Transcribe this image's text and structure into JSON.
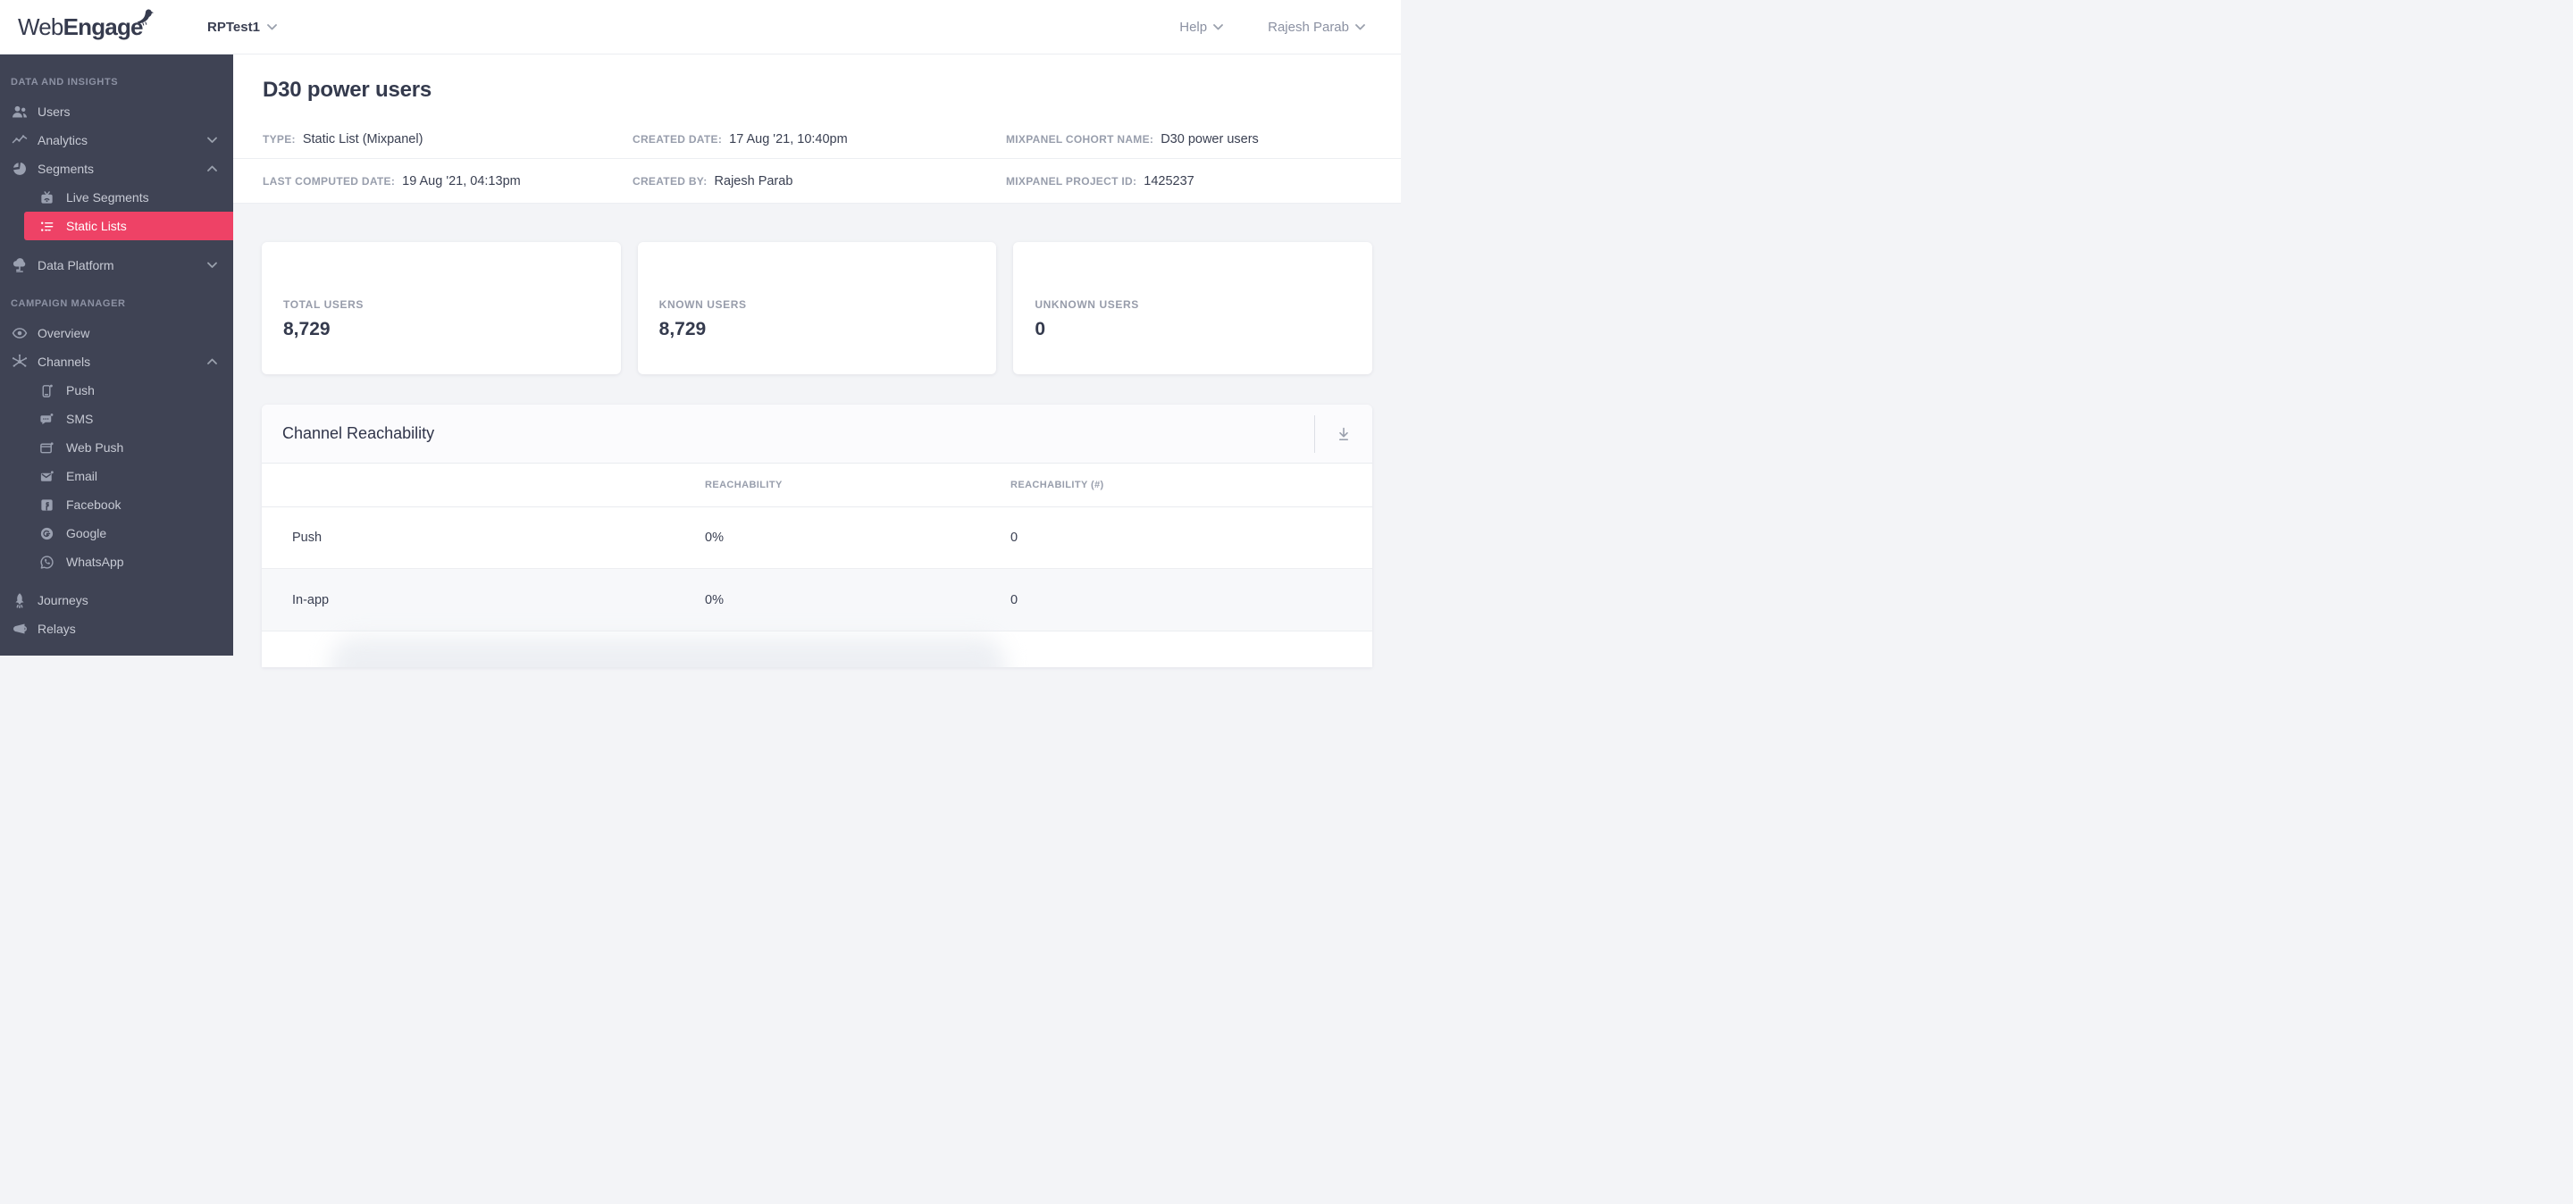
{
  "brand": {
    "light": "Web",
    "bold": "Engage"
  },
  "topbar": {
    "workspace": "RPTest1",
    "help": "Help",
    "user": "Rajesh Parab"
  },
  "colors": {
    "accent": "#ee4266",
    "sidebar_bg": "#3f4354"
  },
  "icons": {
    "brand": "webengage-bird-icon",
    "workspace": "chevron-down-icon",
    "download": "download-icon"
  },
  "sidebar": {
    "section1": "DATA AND INSIGHTS",
    "section2": "CAMPAIGN MANAGER",
    "items1": [
      {
        "label": "Users",
        "icon": "users-icon"
      },
      {
        "label": "Analytics",
        "icon": "analytics-icon",
        "chevron": "down"
      },
      {
        "label": "Segments",
        "icon": "segments-icon",
        "chevron": "up"
      },
      {
        "label": "Live Segments",
        "icon": "live-segments-icon",
        "sub": true
      },
      {
        "label": "Static Lists",
        "icon": "static-lists-icon",
        "sub": true,
        "active": true
      },
      {
        "label": "Data Platform",
        "icon": "data-platform-icon",
        "chevron": "down"
      }
    ],
    "items2": [
      {
        "label": "Overview",
        "icon": "overview-icon"
      },
      {
        "label": "Channels",
        "icon": "channels-icon",
        "chevron": "up"
      },
      {
        "label": "Push",
        "icon": "push-icon",
        "sub": true
      },
      {
        "label": "SMS",
        "icon": "sms-icon",
        "sub": true
      },
      {
        "label": "Web Push",
        "icon": "web-push-icon",
        "sub": true
      },
      {
        "label": "Email",
        "icon": "email-icon",
        "sub": true
      },
      {
        "label": "Facebook",
        "icon": "facebook-icon",
        "sub": true
      },
      {
        "label": "Google",
        "icon": "google-icon",
        "sub": true
      },
      {
        "label": "WhatsApp",
        "icon": "whatsapp-icon",
        "sub": true
      },
      {
        "label": "Journeys",
        "icon": "journeys-icon"
      },
      {
        "label": "Relays",
        "icon": "relays-icon"
      }
    ]
  },
  "page": {
    "title": "D30 power users",
    "meta": [
      {
        "label": "TYPE:",
        "value": "Static List (Mixpanel)"
      },
      {
        "label": "CREATED DATE:",
        "value": "17 Aug '21, 10:40pm"
      },
      {
        "label": "MIXPANEL COHORT NAME:",
        "value": "D30 power users"
      },
      {
        "label": "LAST COMPUTED DATE:",
        "value": "19 Aug '21, 04:13pm"
      },
      {
        "label": "CREATED BY:",
        "value": "Rajesh Parab"
      },
      {
        "label": "MIXPANEL PROJECT ID:",
        "value": "1425237"
      }
    ]
  },
  "stats": [
    {
      "label": "TOTAL USERS",
      "value": "8,729"
    },
    {
      "label": "KNOWN USERS",
      "value": "8,729"
    },
    {
      "label": "UNKNOWN USERS",
      "value": "0"
    }
  ],
  "reachability": {
    "title": "Channel Reachability",
    "columns": [
      "REACHABILITY",
      "REACHABILITY (#)"
    ],
    "rows": [
      {
        "channel": "Push",
        "pct": "0%",
        "count": "0"
      },
      {
        "channel": "In-app",
        "pct": "0%",
        "count": "0"
      }
    ]
  }
}
